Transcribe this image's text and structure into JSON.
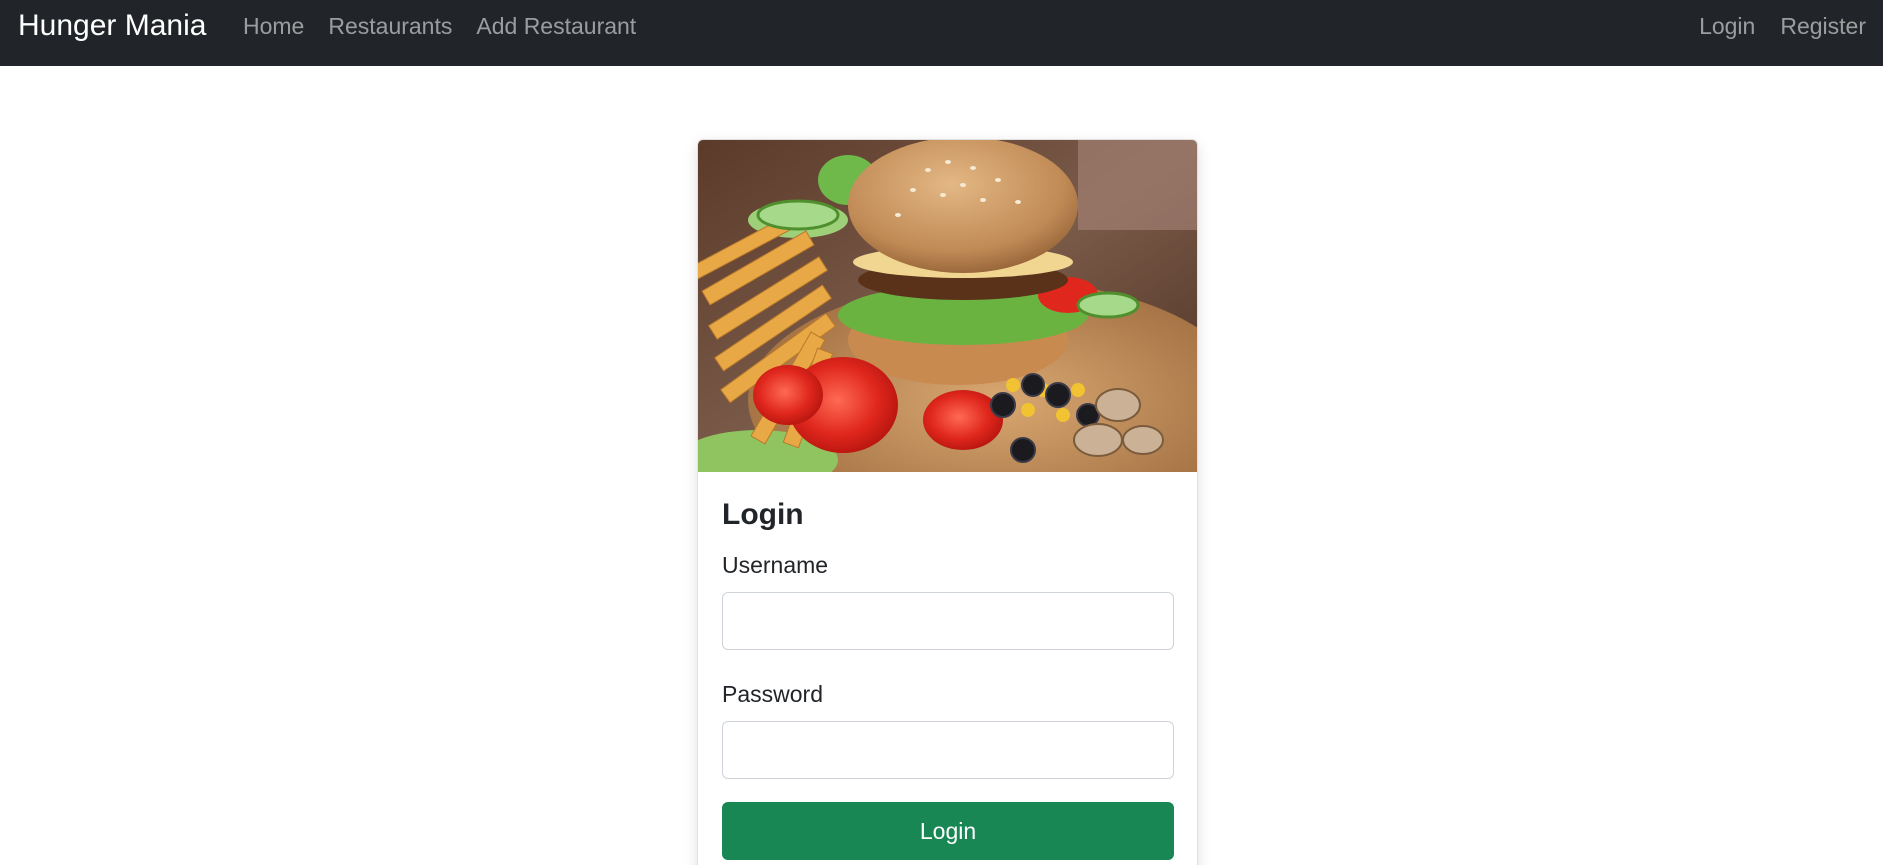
{
  "navbar": {
    "brand": "Hunger Mania",
    "links_left": [
      "Home",
      "Restaurants",
      "Add Restaurant"
    ],
    "links_right": [
      "Login",
      "Register"
    ]
  },
  "login_card": {
    "image_subject": "burger with fries, tomatoes, olives and mushrooms on a wooden board",
    "title": "Login",
    "username_label": "Username",
    "username_value": "",
    "password_label": "Password",
    "password_value": "",
    "submit_label": "Login"
  },
  "colors": {
    "navbar_bg": "#212529",
    "brand_text": "#ffffff",
    "nav_link_text": "rgba(255,255,255,0.55)",
    "button_bg": "#198754"
  }
}
